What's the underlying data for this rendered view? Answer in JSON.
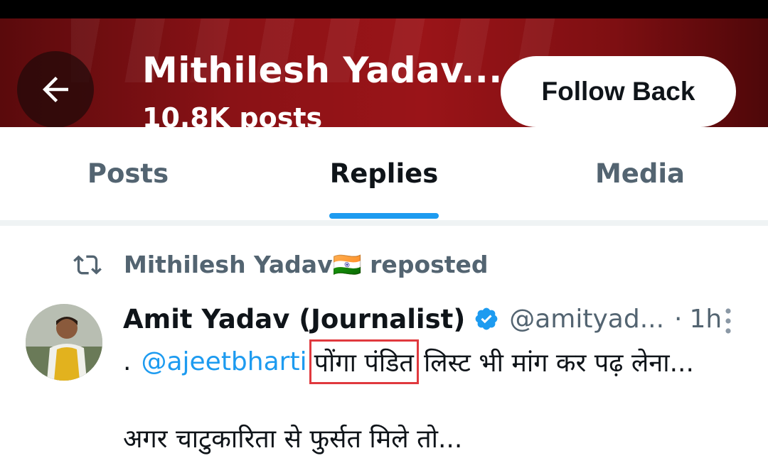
{
  "header": {
    "back_icon": "arrow-left-icon",
    "name": "Mithilesh Yadav...",
    "post_count": "10.8K posts",
    "follow_back_label": "Follow Back",
    "banner_color": "#8a1216"
  },
  "tabs": [
    {
      "label": "Posts",
      "active": false
    },
    {
      "label": "Replies",
      "active": true
    },
    {
      "label": "Media",
      "active": false
    }
  ],
  "accent_color": "#1d9bf0",
  "tweet": {
    "repost_icon": "repost-icon",
    "reposted_by": "Mithilesh Yadav🇮🇳 reposted",
    "author": "Amit Yadav (Journalist)",
    "verified_icon": "verified-badge-icon",
    "handle": "@amityad...",
    "separator": "·",
    "time": "1h",
    "more_icon": "more-vertical-icon",
    "body_lead": ".",
    "mention": "@ajeetbharti",
    "highlighted_text": "पोंगा पंडित",
    "body_rest": "लिस्ट भी मांग कर पढ़ लेना...",
    "body_line2": "अगर चाटुकारिता से फुर्सत मिले तो..."
  }
}
